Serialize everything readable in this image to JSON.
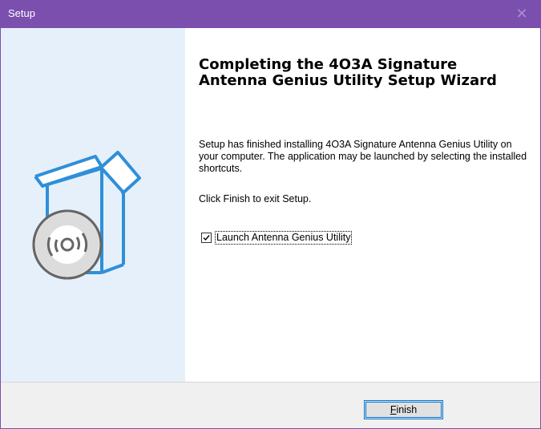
{
  "window": {
    "title": "Setup",
    "close_glyph": "✕",
    "accent_color": "#7a4fae"
  },
  "left_panel": {
    "graphic_icon": "installer-box-disc-icon"
  },
  "content": {
    "heading": "Completing the 4O3A Signature Antenna Genius Utility Setup Wizard",
    "body": "Setup has finished installing 4O3A Signature Antenna Genius Utility on your computer. The application may be launched by selecting the installed shortcuts.",
    "exit_text": "Click Finish to exit Setup.",
    "launch_checkbox": {
      "label": "Launch Antenna Genius Utility",
      "checked": true
    }
  },
  "footer": {
    "finish_label_accel": "F",
    "finish_label_rest": "inish"
  }
}
